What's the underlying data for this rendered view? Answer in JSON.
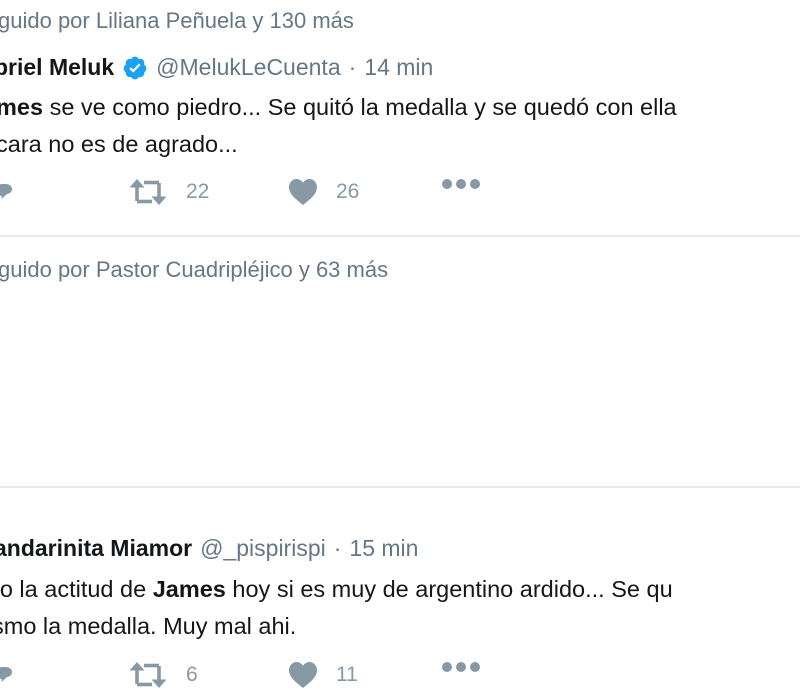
{
  "tweets": [
    {
      "context": "guido por Liliana Peñuela y 130 más",
      "name": "briel Meluk",
      "handle": "@MelukLeCuenta",
      "sep": "·",
      "time": "14 min",
      "verified": true,
      "line1_pre": "",
      "line1_bold": "mes",
      "line1_post": " se ve como piedro... Se quitó la medalla y se quedó con ella",
      "line2": " cara no es de agrado...",
      "retweets": "22",
      "likes": "26"
    },
    {
      "context": "guido por Pastor Cuadripléjico y 63 más",
      "name": "andarinita Miamor",
      "handle": "@_pispirispi",
      "sep": "·",
      "time": "15 min",
      "verified": false,
      "line1_pre": "ro la actitud de ",
      "line1_bold": "James",
      "line1_post": " hoy si es muy  de argentino ardido... Se qu",
      "line2": "smo la medalla. Muy mal ahi.",
      "retweets": "6",
      "likes": "11"
    }
  ],
  "icons": {
    "reply": "reply-icon",
    "retweet": "retweet-icon",
    "like": "heart-icon",
    "more": "more-dots-icon",
    "verified": "verified-badge-icon"
  },
  "colors": {
    "text": "#14171a",
    "muted": "#657786",
    "icon": "#8899a6",
    "verified": "#1da1f2",
    "divider": "#e6ecf0"
  }
}
